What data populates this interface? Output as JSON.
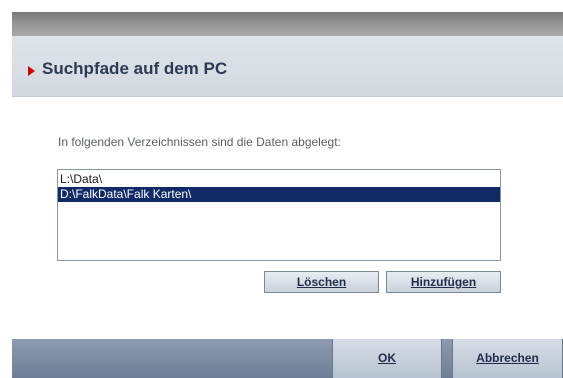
{
  "dialog": {
    "header_title": "Suchpfade auf dem PC",
    "prompt": "In folgenden Verzeichnissen sind die Daten abgelegt:"
  },
  "paths": [
    {
      "label": "L:\\Data\\",
      "selected": false
    },
    {
      "label": "D:\\FalkData\\Falk Karten\\",
      "selected": true
    }
  ],
  "buttons": {
    "delete_label": "Löschen",
    "add_label": "Hinzufügen",
    "ok_label": "OK",
    "cancel_label": "Abbrechen"
  },
  "colors": {
    "accent_arrow": "#cc0000",
    "selection": "#0f2a66",
    "title_text": "#2b3a55"
  }
}
